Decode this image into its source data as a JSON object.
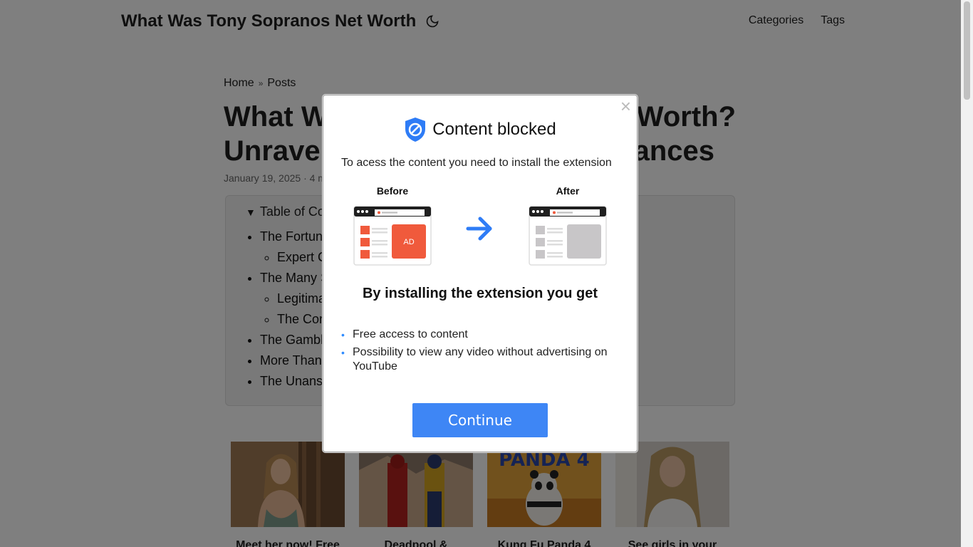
{
  "site": {
    "title": "What Was Tony Sopranos Net Worth",
    "nav": [
      "Categories",
      "Tags"
    ]
  },
  "breadcrumb": [
    "Home",
    "Posts"
  ],
  "post": {
    "title_line1": "What W",
    "title_line1_right": "Worth?",
    "title_line2": "Unravel",
    "title_line2_right": "ances",
    "meta": "January 19, 2025 · 4 m"
  },
  "toc": {
    "summary": "Table of Co",
    "items": [
      {
        "label": "The Fortun",
        "children": [
          "Expert C"
        ]
      },
      {
        "label": "The Many S",
        "children": [
          "Legitima",
          "The Cor"
        ]
      },
      {
        "label": "The Gambl",
        "children": []
      },
      {
        "label": "More Than",
        "children": []
      },
      {
        "label": "The Unansv",
        "children": []
      }
    ]
  },
  "recommendations": [
    {
      "title": "Meet her now! Free",
      "icon": "woman-photo"
    },
    {
      "title": "Deadpool &",
      "icon": "movie-poster"
    },
    {
      "title": "Kung Fu Panda 4",
      "icon": "movie-poster",
      "poster_text": "PANDA 4"
    },
    {
      "title": "See girls in your",
      "icon": "woman-photo"
    }
  ],
  "modal": {
    "title": "Content blocked",
    "subtitle": "To acess the content you need to install the extension",
    "before_label": "Before",
    "after_label": "After",
    "ad_label": "AD",
    "benefits_title": "By installing the extension you get",
    "benefits": [
      "Free access to content",
      "Possibility to view any video without advertising on YouTube"
    ],
    "continue_label": "Continue",
    "close_label": "×"
  },
  "colors": {
    "accent": "#3e86f5",
    "ad_red": "#f05a3c",
    "shield": "#2e7cf6"
  }
}
